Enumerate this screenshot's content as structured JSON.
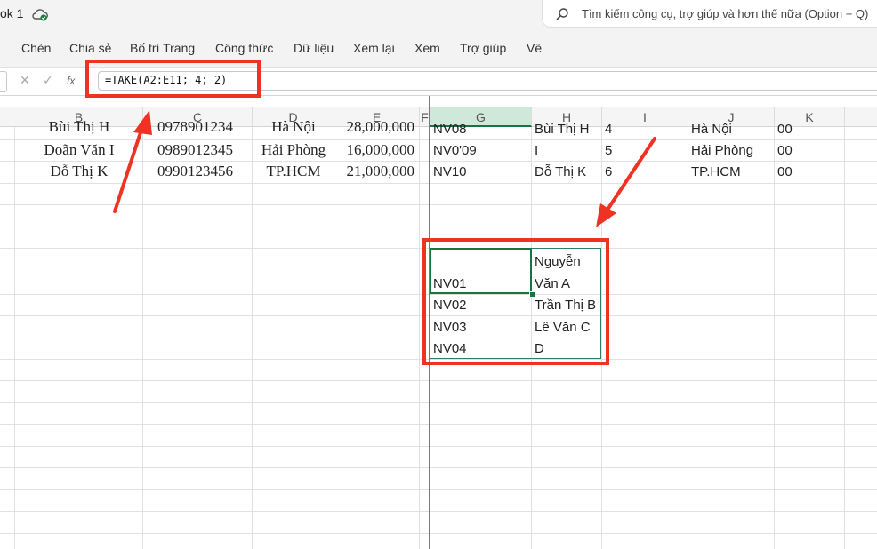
{
  "app": {
    "title_fragment": "ok 1",
    "search_placeholder": "Tìm kiếm công cụ, trợ giúp và hơn thế nữa (Option + Q)"
  },
  "menu": [
    "Chèn",
    "Chia sẻ",
    "Bố trí Trang",
    "Công thức",
    "Dữ liệu",
    "Xem lại",
    "Xem",
    "Trợ giúp",
    "Vẽ"
  ],
  "formula_bar": {
    "fx_label": "fx",
    "formula": "=TAKE(A2:E11; 4; 2)"
  },
  "columns": [
    "B",
    "C",
    "D",
    "E",
    "F",
    "G",
    "H",
    "I",
    "J",
    "K"
  ],
  "left_rows": [
    {
      "name": "Bùi Thị H",
      "phone": "0978901234",
      "city": "Hà Nội",
      "salary": "28,000,000"
    },
    {
      "name": "Doãn Văn I",
      "phone": "0989012345",
      "city": "Hải Phòng",
      "salary": "16,000,000"
    },
    {
      "name": "Đỗ Thị K",
      "phone": "0990123456",
      "city": "TP.HCM",
      "salary": "21,000,000"
    }
  ],
  "right_rows": [
    {
      "g": "NV08",
      "h": "Bùi Thị H",
      "i": "4",
      "j": "Hà Nội",
      "k": "00"
    },
    {
      "g": "NV0'09",
      "h": "I",
      "i": "5",
      "j": "Hải Phòng",
      "k": "00"
    },
    {
      "g": "NV10",
      "h": "Đỗ Thị K",
      "i": "6",
      "j": "TP.HCM",
      "k": "00"
    }
  ],
  "result": {
    "row1": {
      "g": "NV01",
      "h_line1": "Nguyễn",
      "h_line2": "Văn A"
    },
    "rows": [
      {
        "g": "NV02",
        "h": "Trần Thị B"
      },
      {
        "g": "NV03",
        "h": "Lê Văn C"
      },
      {
        "g": "NV04",
        "h": "D"
      }
    ]
  },
  "colors": {
    "annotation_red": "#ee3322",
    "selection_green": "#1a7343"
  }
}
